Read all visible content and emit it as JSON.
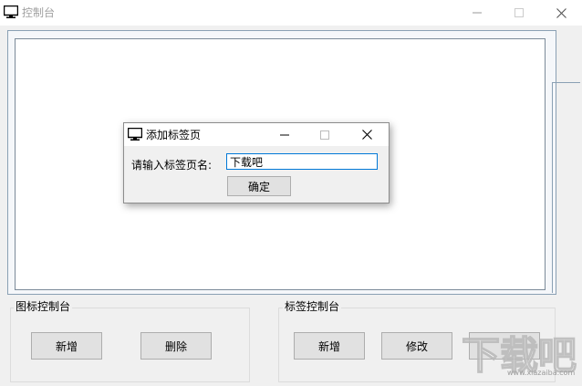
{
  "window": {
    "title": "控制台",
    "icon": "monitor-icon",
    "controls": [
      "minimize-icon",
      "maximize-icon",
      "close-icon"
    ]
  },
  "icon_group": {
    "title": "图标控制台",
    "add_label": "新增",
    "delete_label": "删除"
  },
  "tab_group": {
    "title": "标签控制台",
    "add_label": "新增",
    "edit_label": "修改"
  },
  "dialog": {
    "title": "添加标签页",
    "icon": "monitor-icon",
    "prompt": "请输入标签页名:",
    "input_value": "下载吧",
    "ok_label": "确定"
  },
  "watermark": {
    "logo_text": "下载吧",
    "url": "www.xiazaiba.com"
  },
  "colors": {
    "window_bg": "#f0f0f0",
    "input_focus_border": "#0078d7",
    "button_bg": "#e1e1e1"
  }
}
